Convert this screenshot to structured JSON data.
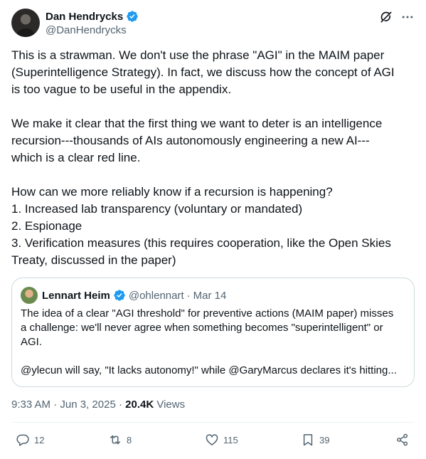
{
  "author": {
    "display_name": "Dan Hendrycks",
    "handle": "@DanHendrycks",
    "verified": true
  },
  "header_icons": [
    "grok-icon",
    "more-icon"
  ],
  "body": {
    "p1": [
      "This is a strawman. We don't use the phrase \"AGI\" in the MAIM paper",
      "(Superintelligence Strategy). In fact, we discuss how the concept of AGI",
      "is too vague to be useful in the appendix."
    ],
    "p2": [
      "We make it clear that the first thing we want to deter is an intelligence",
      "recursion---thousands of AIs autonomously engineering a new AI---",
      "which is a clear red line."
    ],
    "p3": [
      "How can we more reliably know if a recursion is happening?",
      "1. Increased lab transparency (voluntary or mandated)",
      "2. Espionage",
      "3. Verification measures (this requires cooperation, like the Open Skies",
      "Treaty, discussed in the paper)"
    ]
  },
  "quote": {
    "display_name": "Lennart Heim",
    "handle": "@ohlennart",
    "date": "Mar 14",
    "verified": true,
    "p1": [
      "The idea of a clear \"AGI threshold\" for preventive actions (MAIM paper) misses",
      "a challenge: we'll never agree when something becomes \"superintelligent\" or",
      "AGI."
    ],
    "p2": "@ylecun will say, \"It lacks autonomy!\" while @GaryMarcus declares it's hitting..."
  },
  "meta": {
    "time": "9:33 AM",
    "date": "Jun 3, 2025",
    "views_count": "20.4K",
    "views_label": "Views"
  },
  "actions": {
    "replies": "12",
    "reposts": "8",
    "likes": "115",
    "bookmarks": "39"
  },
  "colors": {
    "verified_blue": "#1d9bf0",
    "secondary_text": "#536471",
    "border": "#cfd9de"
  }
}
